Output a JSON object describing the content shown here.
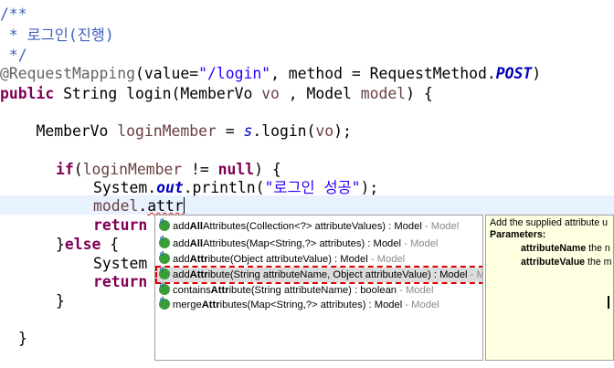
{
  "editor": {
    "lines": {
      "l1": "/**",
      "l2_star": " * ",
      "l2_text": "로그인(진행)",
      "l3": " */",
      "l4_ann": "@RequestMapping",
      "l4_a": "(value=",
      "l4_str": "\"/login\"",
      "l4_b": ", method = RequestMethod.",
      "l4_fld": "POST",
      "l4_c": ")",
      "l5_kw": "public",
      "l5_a": " String login(MemberVo ",
      "l5_var": "vo",
      "l5_b": " , Model ",
      "l5_var2": "model",
      "l5_c": ") {",
      "l6_a": "    MemberVo ",
      "l6_var": "loginMember",
      "l6_b": " = ",
      "l6_fld": "s",
      "l6_c": ".login(",
      "l6_var2": "vo",
      "l6_d": ");",
      "l7_kw": "if",
      "l7_a": "(",
      "l7_var": "loginMember",
      "l7_b": " != ",
      "l7_kw2": "null",
      "l7_c": ") {",
      "l8_a": "System.",
      "l8_fld": "out",
      "l8_b": ".println(",
      "l8_str": "\"로그인 성공\"",
      "l8_c": ");",
      "l9_var": "model",
      "l9_a": ".",
      "l9_typed": "attr",
      "l10_kw": "return",
      "l11_a": "}",
      "l11_kw": "else",
      "l11_b": " {",
      "l12_a": "System",
      "l13_kw": "return",
      "l14": "}",
      "l15": "}"
    }
  },
  "content_assist": {
    "items": [
      {
        "name": "add",
        "bold": "All",
        "name2": "Attributes",
        "sig": "(Collection<?> attributeValues) : Model",
        "qual": " - Model"
      },
      {
        "name": "add",
        "bold": "All",
        "name2": "Attributes",
        "sig": "(Map<String,?> attributes) : Model",
        "qual": " - Model"
      },
      {
        "name": "add",
        "bold": "Attr",
        "name2": "ibute",
        "sig": "(Object attributeValue) : Model",
        "qual": " - Model"
      },
      {
        "name": "add",
        "bold": "Attr",
        "name2": "ibute",
        "sig": "(String attributeName, Object attributeValue) : Model",
        "qual": " - Model"
      },
      {
        "name": "contains",
        "bold": "Attr",
        "name2": "ibute",
        "sig": "(String attributeName) : boolean",
        "qual": " - Model"
      },
      {
        "name": "merge",
        "bold": "Attr",
        "name2": "ibutes",
        "sig": "(Map<String,?> attributes) : Model",
        "qual": " - Model"
      }
    ],
    "selected_index": 3
  },
  "javadoc": {
    "summary": "Add the supplied attribute u",
    "params_heading": "Parameters:",
    "param1_name": "attributeName",
    "param1_desc": " the n",
    "param2_name": "attributeValue",
    "param2_desc": " the m"
  },
  "colors": {
    "comment": "#3f5fbf",
    "keyword": "#7f0055",
    "string": "#2a00ff",
    "field": "#0000c0",
    "local_var": "#6a3e3e",
    "annotation": "#646464",
    "current_line": "#e8f2fe",
    "selection_outline": "#e00000",
    "javadoc_bg": "#ffffe1"
  },
  "icons": {
    "method": "public-method-icon"
  }
}
